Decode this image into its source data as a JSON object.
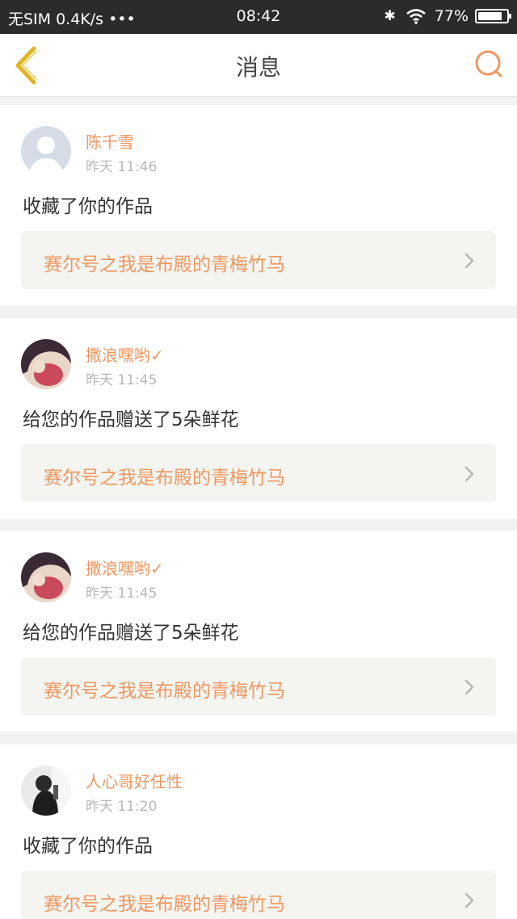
{
  "status_bar": {
    "carrier": "无SIM 0.4K/s •••",
    "time": "08:42",
    "battery": "77%",
    "battery_level": 0.77
  },
  "header": {
    "title": "消息",
    "back_icon": "chevron-left-icon",
    "search_icon": "search-icon"
  },
  "colors": {
    "accent": "#f0975f",
    "back_icon": "#e4b422",
    "status_bar_bg": "#2b2b2b"
  },
  "messages": [
    {
      "user": "陈千雪",
      "time": "昨天 11:46",
      "action": "收藏了你的作品",
      "work": "赛尔号之我是布殿的青梅竹马"
    },
    {
      "user": "撒浪嘿哟✓",
      "time": "昨天 11:45",
      "action": "给您的作品赠送了5朵鲜花",
      "work": "赛尔号之我是布殿的青梅竹马"
    },
    {
      "user": "撒浪嘿哟✓",
      "time": "昨天 11:45",
      "action": "给您的作品赠送了5朵鲜花",
      "work": "赛尔号之我是布殿的青梅竹马"
    },
    {
      "user": "人心哥好任性",
      "time": "昨天 11:20",
      "action": "收藏了你的作品",
      "work": "赛尔号之我是布殿的青梅竹马"
    }
  ]
}
